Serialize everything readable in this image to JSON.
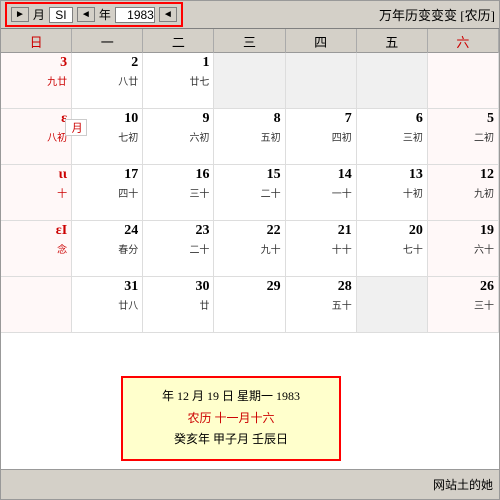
{
  "app": {
    "title": "万年历变变变",
    "subtitle": "[农历] 万年历变变变"
  },
  "header": {
    "year_label": "年",
    "year_value": "1983",
    "month_label": "月",
    "month_value": "SI",
    "arrow_left": "◄",
    "arrow_right": "►"
  },
  "dow": {
    "headers": [
      "六",
      "五",
      "四",
      "三",
      "二",
      "一",
      "日"
    ]
  },
  "weeks": [
    {
      "days": [
        {
          "num": "",
          "lunar": "",
          "empty": true
        },
        {
          "num": "",
          "lunar": "",
          "empty": true
        },
        {
          "num": "",
          "lunar": "",
          "empty": true
        },
        {
          "num": "",
          "lunar": "",
          "empty": true
        },
        {
          "num": "1",
          "lunar": "廿七",
          "red": false
        },
        {
          "num": "2",
          "lunar": "八廿",
          "red": false
        },
        {
          "num": "3",
          "lunar": "九廿",
          "red": true
        }
      ],
      "side": ""
    },
    {
      "days": [
        {
          "num": "5",
          "lunar": "二初",
          "red": false
        },
        {
          "num": "6",
          "lunar": "三初",
          "red": false
        },
        {
          "num": "7",
          "lunar": "四初",
          "red": false
        },
        {
          "num": "8",
          "lunar": "五初",
          "red": false
        },
        {
          "num": "9",
          "lunar": "六初",
          "red": false
        },
        {
          "num": "10",
          "lunar": "七初",
          "red": false
        },
        {
          "num": "ε",
          "lunar": "八初",
          "red": true
        }
      ],
      "side": "月"
    },
    {
      "days": [
        {
          "num": "12",
          "lunar": "九初",
          "red": false
        },
        {
          "num": "13",
          "lunar": "十初",
          "red": false
        },
        {
          "num": "14",
          "lunar": "一十",
          "red": false
        },
        {
          "num": "15",
          "lunar": "二十",
          "red": false
        },
        {
          "num": "16",
          "lunar": "三十",
          "red": false
        },
        {
          "num": "17",
          "lunar": "四十",
          "red": false
        },
        {
          "num": "ιι",
          "lunar": "十",
          "red": true
        }
      ],
      "side": ""
    },
    {
      "days": [
        {
          "num": "19",
          "lunar": "六十",
          "red": false
        },
        {
          "num": "20",
          "lunar": "七十",
          "red": false
        },
        {
          "num": "21",
          "lunar": "十十",
          "red": false
        },
        {
          "num": "22",
          "lunar": "九十",
          "red": false
        },
        {
          "num": "23",
          "lunar": "二十",
          "red": false
        },
        {
          "num": "24",
          "lunar": "春分",
          "red": false
        },
        {
          "num": "εΙ",
          "lunar": "念",
          "red": true
        }
      ],
      "side": ""
    },
    {
      "days": [
        {
          "num": "26",
          "lunar": "三十",
          "red": false
        },
        {
          "num": "",
          "lunar": "",
          "empty": true
        },
        {
          "num": "28",
          "lunar": "五十",
          "red": false
        },
        {
          "num": "29",
          "lunar": "",
          "red": false
        },
        {
          "num": "30",
          "lunar": "廿",
          "red": false
        },
        {
          "num": "31",
          "lunar": "廿八",
          "red": false
        },
        {
          "num": "",
          "lunar": "",
          "empty": true
        }
      ],
      "side": ""
    }
  ],
  "popup": {
    "line1": "1983 年 12 月 19 日 星期一",
    "line2": "农历 十一月十六",
    "line3": "癸亥年 甲子月 壬辰日"
  },
  "bottom": {
    "label": "网站土的她"
  }
}
